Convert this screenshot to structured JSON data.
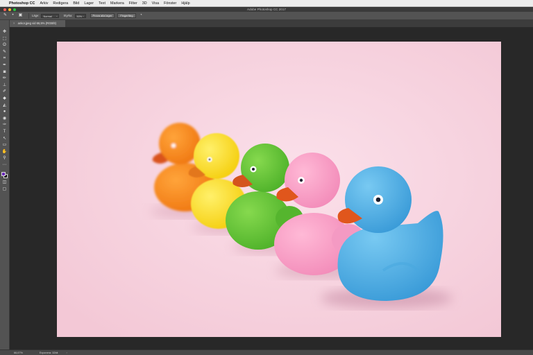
{
  "menubar": {
    "apple_icon": "apple-icon",
    "app_name": "Photoshop CC",
    "items": [
      "Arkiv",
      "Redigera",
      "Bild",
      "Lager",
      "Text",
      "Markera",
      "Filter",
      "3D",
      "Visa",
      "Fönster",
      "Hjälp"
    ]
  },
  "titlebar": {
    "title": "Adobe Photoshop CC 2017",
    "traffic_colors": [
      "#fe5f57",
      "#febc2e",
      "#28c840"
    ]
  },
  "options": {
    "lage_label": "Läge:",
    "lage_value": "Normal",
    "styrka_label": "Styrka:",
    "styrka_value": "50%",
    "sample_all_layers_label": "Prova alla lager",
    "refine_label": "Fingerfärg"
  },
  "document": {
    "tab_title": "ankor.jpeg vid 66,5% (RGB/8)",
    "close_glyph": "×"
  },
  "status": {
    "zoom": "66,67%",
    "doc_info": "Exponera: 32bit",
    "arrow": "›"
  },
  "colors": {
    "foreground": "#6a2cb8",
    "background": "#111111",
    "canvas_bg": "#f7d3df"
  },
  "tools": [
    "move-tool",
    "marquee-tool",
    "lasso-tool",
    "quick-select-tool",
    "crop-tool",
    "eyedropper-tool",
    "healing-brush-tool",
    "brush-tool",
    "clone-stamp-tool",
    "history-brush-tool",
    "eraser-tool",
    "gradient-tool",
    "blur-tool",
    "dodge-tool",
    "pen-tool",
    "type-tool",
    "path-select-tool",
    "shape-tool",
    "hand-tool",
    "zoom-tool",
    "more-tools"
  ]
}
